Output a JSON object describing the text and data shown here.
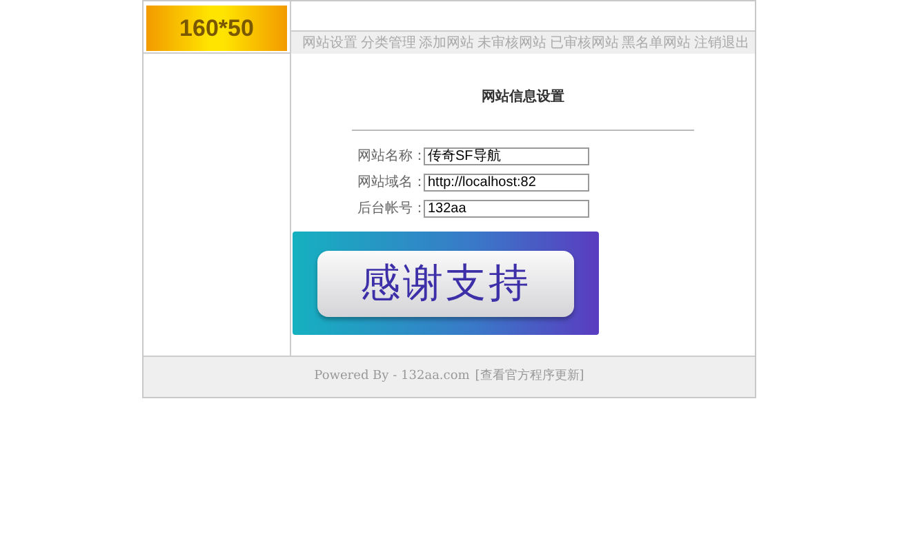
{
  "logo": {
    "text": "160*50"
  },
  "nav": [
    {
      "label": "网站设置"
    },
    {
      "label": "分类管理"
    },
    {
      "label": "添加网站"
    },
    {
      "label": "未审核网站"
    },
    {
      "label": "已审核网站"
    },
    {
      "label": "黑名单网站"
    },
    {
      "label": "注销退出"
    }
  ],
  "form": {
    "title": "网站信息设置",
    "fields": [
      {
        "label": "网站名称：",
        "value": "传奇SF导航"
      },
      {
        "label": "网站域名：",
        "value": "http://localhost:82"
      },
      {
        "label": "后台帐号：",
        "value": "132aa"
      }
    ]
  },
  "banner": {
    "text": "感谢支持"
  },
  "footer": {
    "text": "Powered By - 132aa.com",
    "link": "[查看官方程序更新]"
  }
}
